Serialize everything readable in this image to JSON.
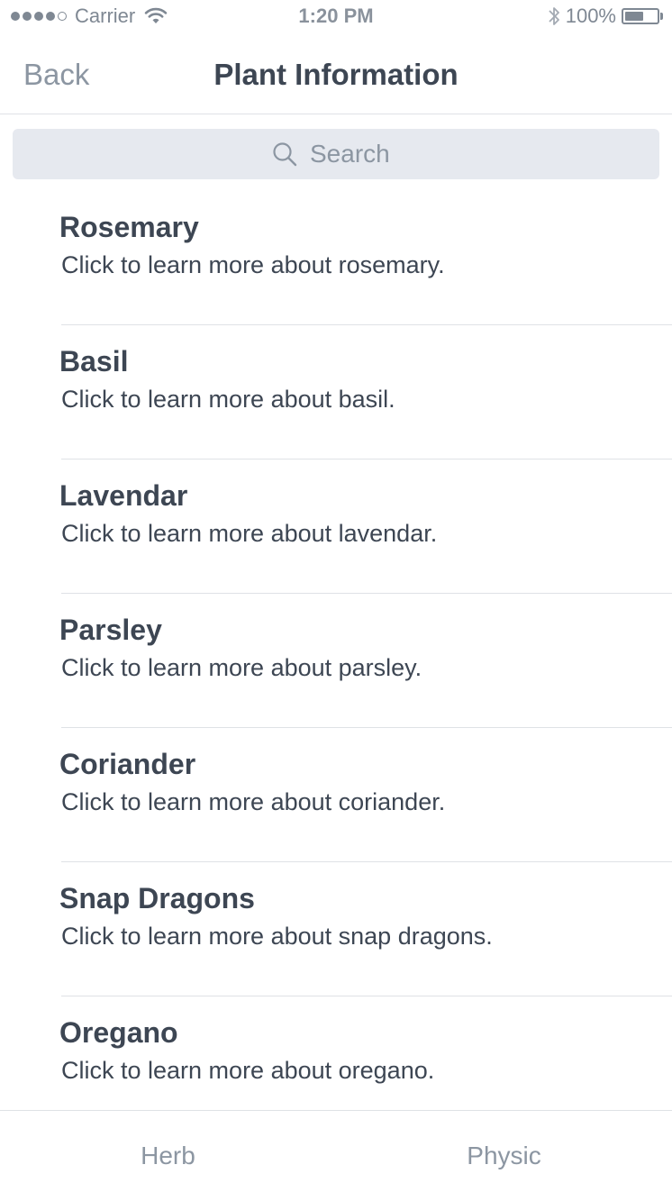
{
  "status_bar": {
    "carrier": "Carrier",
    "time": "1:20 PM",
    "battery": "100%",
    "signal_bars": 4,
    "signal_total": 5,
    "battery_level": 0.6,
    "icons": [
      "signal-icon",
      "wifi-icon",
      "bluetooth-icon",
      "battery-icon"
    ]
  },
  "nav": {
    "back_label": "Back",
    "title": "Plant Information"
  },
  "search": {
    "placeholder": "Search",
    "value": ""
  },
  "plants": [
    {
      "name": "Rosemary",
      "description": "Click to learn more about rosemary."
    },
    {
      "name": "Basil",
      "description": "Click to learn more about basil."
    },
    {
      "name": "Lavendar",
      "description": "Click to learn more about lavendar."
    },
    {
      "name": "Parsley",
      "description": "Click to learn more about parsley."
    },
    {
      "name": "Coriander",
      "description": "Click to learn more about coriander."
    },
    {
      "name": "Snap Dragons",
      "description": "Click to learn more about snap dragons."
    },
    {
      "name": "Oregano",
      "description": "Click to learn more about oregano."
    }
  ],
  "tabs": [
    {
      "label": "Herb"
    },
    {
      "label": "Physic"
    }
  ],
  "colors": {
    "text_primary": "#3d4653",
    "text_muted": "#8c96a2",
    "search_bg": "#e6e9ef",
    "divider": "#dfe2e6"
  }
}
